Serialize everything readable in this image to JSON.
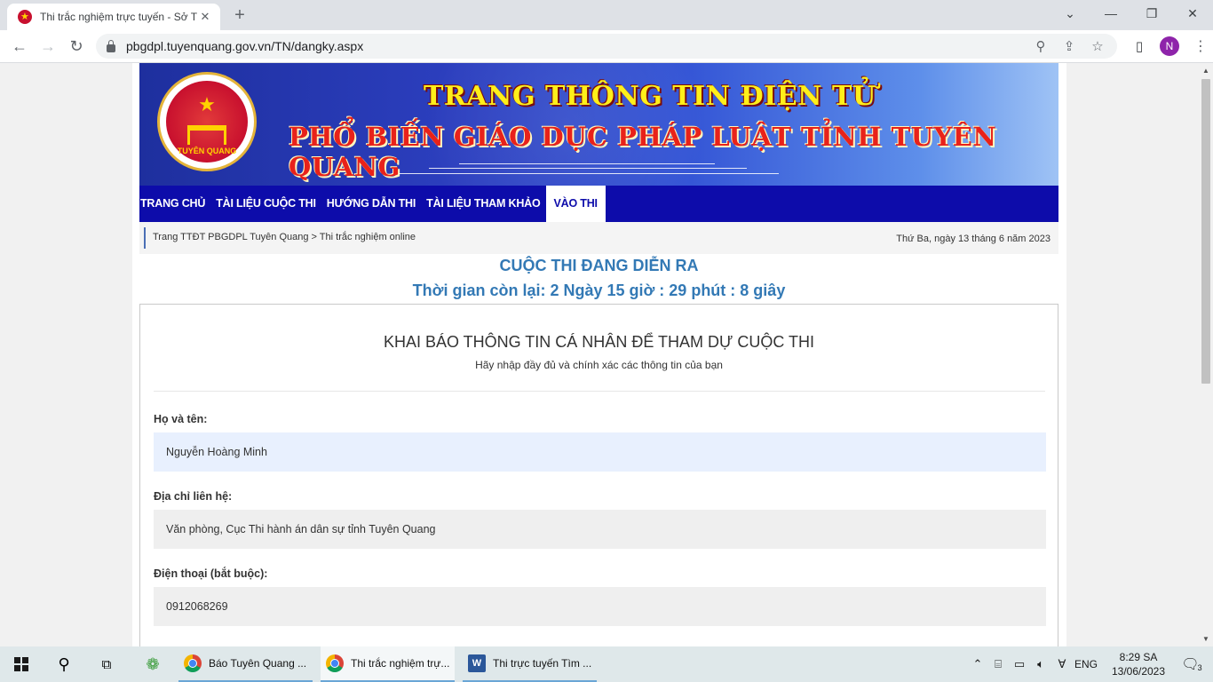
{
  "browser": {
    "tab_title": "Thi trắc nghiệm trực tuyến - Sở T",
    "tab_close": "✕",
    "new_tab": "+",
    "url": "pbgdpl.tuyenquang.gov.vn/TN/dangky.aspx",
    "profile_initial": "N"
  },
  "banner": {
    "title_line1": "TRANG THÔNG TIN ĐIỆN TỬ",
    "title_line2": "PHỔ BIẾN GIÁO DỤC PHÁP LUẬT TỈNH TUYÊN QUANG",
    "emblem_text": "TUYÊN QUANG"
  },
  "nav": {
    "items": [
      {
        "label": "TRANG CHỦ"
      },
      {
        "label": "TÀI LIỆU CUỘC THI"
      },
      {
        "label": "HƯỚNG DẪN THI"
      },
      {
        "label": "TÀI LIỆU THAM KHẢO"
      },
      {
        "label": "VÀO THI"
      }
    ]
  },
  "breadcrumb": {
    "text": "Trang TTĐT PBGDPL Tuyên Quang > Thi trắc nghiệm online",
    "date": "Thứ Ba, ngày 13 tháng 6 năm 2023"
  },
  "contest": {
    "status": "CUỘC THI ĐANG DIỄN RA",
    "countdown": "Thời gian còn lại: 2 Ngày 15 giờ : 29 phút : 8 giây"
  },
  "form": {
    "title": "KHAI BÁO THÔNG TIN CÁ NHÂN ĐỂ THAM DỰ CUỘC THI",
    "subtitle": "Hãy nhập đầy đủ và chính xác các thông tin của bạn",
    "fields": [
      {
        "label": "Họ và tên:",
        "value": "Nguyễn Hoàng Minh"
      },
      {
        "label": "Địa chỉ liên hệ:",
        "value": "Văn phòng, Cục Thi hành án dân sự tỉnh Tuyên Quang"
      },
      {
        "label": "Điện thoại (bắt buộc):",
        "value": "0912068269"
      }
    ]
  },
  "taskbar": {
    "apps": [
      {
        "label": "Báo Tuyên Quang ..."
      },
      {
        "label": "Thi trắc nghiệm trự..."
      },
      {
        "label": "Thi trực tuyến Tìm ..."
      }
    ],
    "language": "ENG",
    "time": "8:29 SA",
    "date": "13/06/2023",
    "notification_count": "3"
  },
  "icons": {
    "back": "←",
    "forward": "→",
    "reload": "↻",
    "zoom": "⌕",
    "share": "⇪",
    "star": "☆",
    "kebab": "⋮",
    "search": "⚲"
  }
}
